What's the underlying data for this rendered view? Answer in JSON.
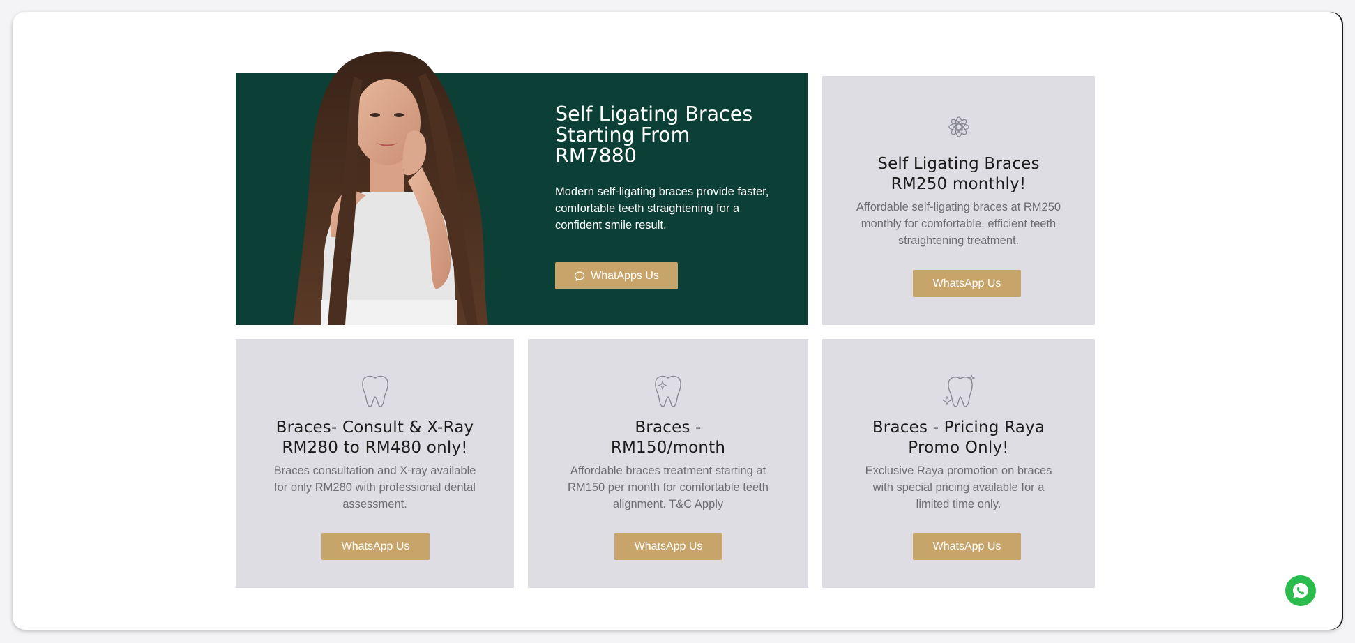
{
  "hero": {
    "title": "Self Ligating Braces Starting From RM7880",
    "description": "Modern self-ligating braces provide faster, comfortable teeth straightening for a confident smile result.",
    "button_label": "WhatApps Us",
    "background_color": "#0c3f35",
    "image": "smiling-woman-portrait"
  },
  "cards": [
    {
      "icon": "lotus-icon",
      "title": "Self Ligating Braces RM250 monthly!",
      "description": "Affordable self-ligating braces at RM250 monthly for comfortable, efficient teeth straightening treatment.",
      "button_label": "WhatsApp Us"
    },
    {
      "icon": "tooth-icon",
      "title": "Braces- Consult & X-Ray RM280 to RM480 only!",
      "description": "Braces consultation and X-ray available for only RM280 with professional dental assessment.",
      "button_label": "WhatsApp Us"
    },
    {
      "icon": "sparkle-tooth-icon",
      "title": "Braces - RM150/month",
      "description": "Affordable braces treatment starting at RM150 per month for comfortable teeth alignment. T&C Apply",
      "button_label": "WhatsApp Us"
    },
    {
      "icon": "shining-tooth-icon",
      "title": "Braces - Pricing Raya Promo Only!",
      "description": "Exclusive Raya promotion on braces with special pricing available for a limited time only.",
      "button_label": "WhatsApp Us"
    }
  ],
  "colors": {
    "accent": "#c7a46a",
    "card_background": "#dedde3",
    "whatsapp_green": "#2bbc4e"
  },
  "floating_button": {
    "icon": "whatsapp-icon"
  }
}
